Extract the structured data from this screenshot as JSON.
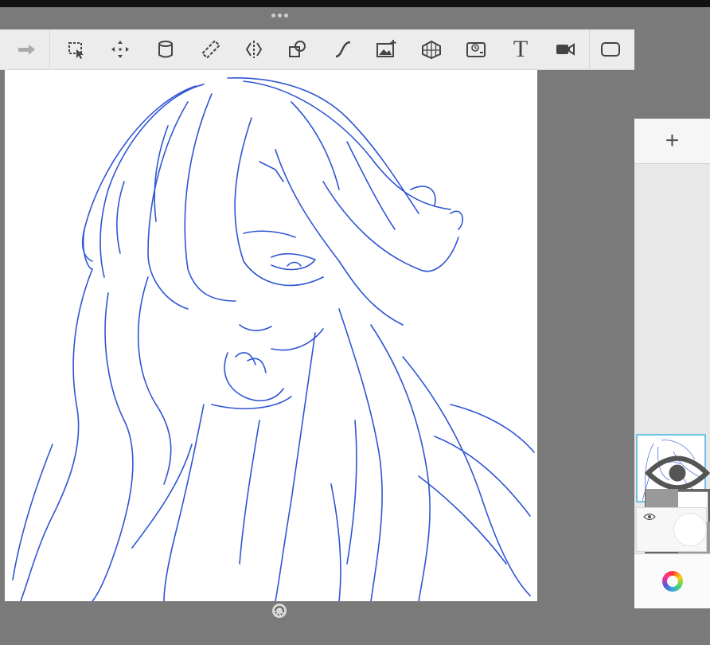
{
  "app": {
    "name": "Drawing canvas"
  },
  "toolbar": {
    "tools": [
      {
        "name": "redo",
        "icon": "redo-arrow-icon"
      },
      {
        "name": "selection",
        "icon": "select-icon"
      },
      {
        "name": "transform",
        "icon": "move-icon"
      },
      {
        "name": "fill",
        "icon": "fill-bucket-icon"
      },
      {
        "name": "ruler",
        "icon": "ruler-icon"
      },
      {
        "name": "symmetry",
        "icon": "symmetry-icon"
      },
      {
        "name": "shape",
        "icon": "shape-icon"
      },
      {
        "name": "curve",
        "icon": "curve-icon"
      },
      {
        "name": "insert-image",
        "icon": "image-add-icon"
      },
      {
        "name": "perspective",
        "icon": "perspective-grid-icon"
      },
      {
        "name": "timelapse",
        "icon": "timelapse-icon"
      },
      {
        "name": "text",
        "icon": "text-icon",
        "glyph": "T"
      },
      {
        "name": "record",
        "icon": "video-camera-icon"
      },
      {
        "name": "fullscreen",
        "icon": "fullscreen-icon"
      }
    ]
  },
  "layers": {
    "add_label": "+",
    "items": [
      {
        "name": "sketch-layer",
        "visible": true,
        "selected": true
      },
      {
        "name": "background-layer",
        "visible": true,
        "selected": false
      }
    ]
  },
  "colors": {
    "background": "#7a7a7a",
    "toolbar": "#ececec",
    "stroke": "#2f55d4",
    "selection": "#6fc3e6"
  }
}
